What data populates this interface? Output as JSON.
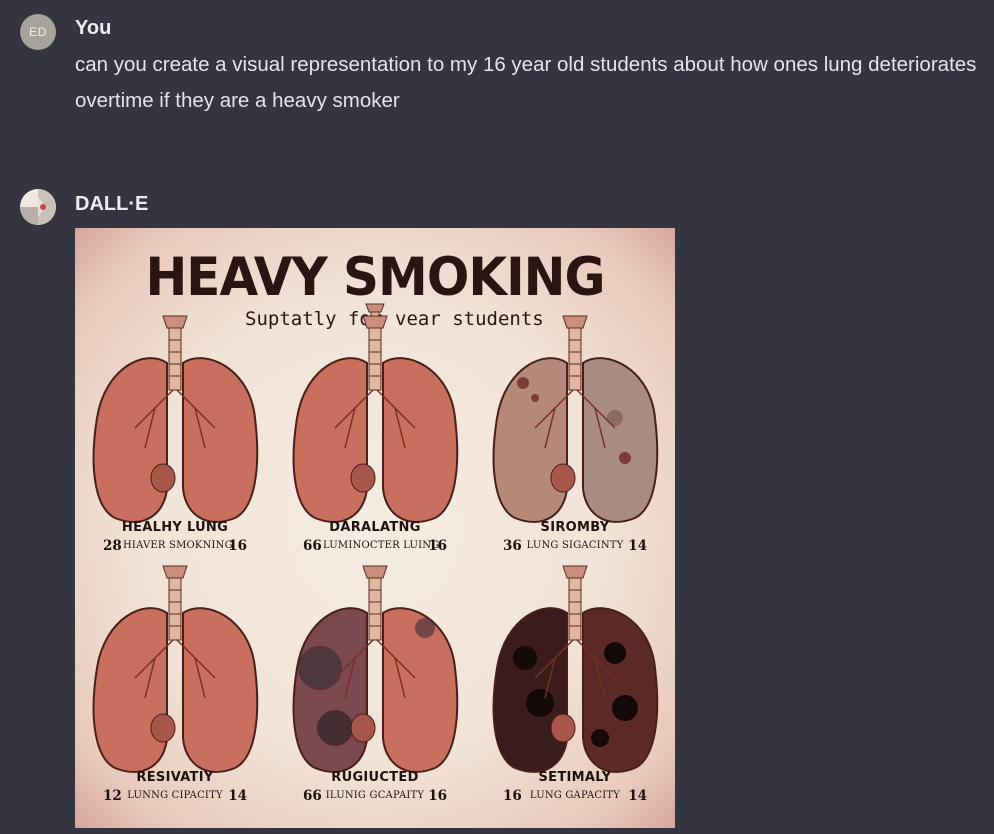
{
  "conversation": {
    "user": {
      "avatar_initials": "ED",
      "name": "You",
      "message": "can you create a visual representation to my 16 year old students about how ones lung deteriorates overtime if they are a heavy smoker"
    },
    "assistant": {
      "name": "DALL·E",
      "image": {
        "title": "HEAVY SMOKING",
        "subtitle_left": "Suptatly for",
        "subtitle_right": "vear students",
        "panels": [
          {
            "caption": "HEALHY LUNG",
            "left_num": "28",
            "label": "HIAVER SMOKNING",
            "right_num": "16"
          },
          {
            "caption": "DARALATNG",
            "left_num": "66",
            "label": "LUMINOCTER LUING",
            "right_num": "16"
          },
          {
            "caption": "SIROMBY",
            "left_num": "36",
            "label": "LUNG SIGACINTY",
            "right_num": "14"
          },
          {
            "caption": "RESIVATIY",
            "left_num": "12",
            "label": "LUNNG CIPACITY",
            "right_num": "14"
          },
          {
            "caption": "RUGIUCTED",
            "left_num": "66",
            "label": "ILUNIG GCAPAITY",
            "right_num": "16"
          },
          {
            "caption": "SETIMALY",
            "left_num": "16",
            "label": "LUNG GAPACITY",
            "right_num": "14"
          }
        ]
      }
    }
  },
  "colors": {
    "background": "#343541",
    "lung_healthy": "#c96f5f",
    "lung_damaged": "#7a4a4e",
    "lung_dark": "#3a1c1c",
    "trachea": "#e2b7a2"
  }
}
